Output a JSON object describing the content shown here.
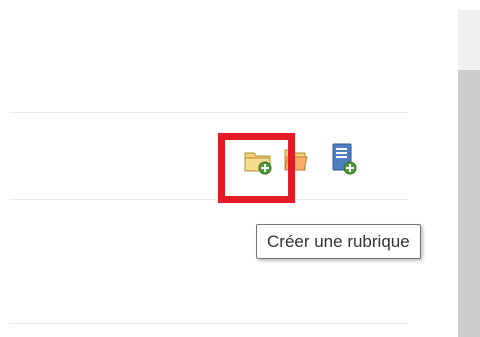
{
  "toolbar": {
    "icons": [
      {
        "name": "create-section-icon",
        "action": "Créer une rubrique"
      },
      {
        "name": "folder-icon"
      },
      {
        "name": "add-document-icon"
      }
    ],
    "highlight_color": "#e21b24"
  },
  "tooltip": {
    "text": "Créer une rubrique"
  }
}
